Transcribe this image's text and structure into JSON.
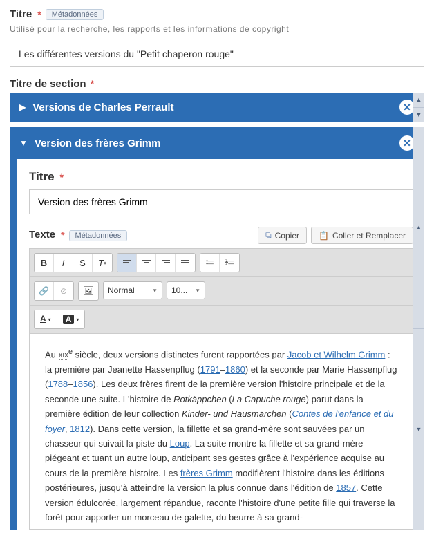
{
  "title_field": {
    "label": "Titre",
    "meta_badge": "Métadonnées",
    "hint": "Utilisé pour la recherche, les rapports et les informations de copyright",
    "value": "Les différentes versions du \"Petit chaperon rouge\""
  },
  "section_label": "Titre de section",
  "sections": [
    {
      "title": "Versions de Charles Perrault",
      "expanded": false
    },
    {
      "title": "Version des frères Grimm",
      "expanded": true
    }
  ],
  "detail": {
    "title_label": "Titre",
    "title_value": "Version des frères Grimm",
    "text_label": "Texte",
    "meta_badge": "Métadonnées",
    "copy_btn": "Copier",
    "paste_btn": "Coller et Remplacer",
    "format_sel": "Normal",
    "size_sel": "10...",
    "content": {
      "t1": "Au ",
      "century": "xix",
      "sup": "e",
      "t2": " siècle, deux versions distinctes furent rapportées par ",
      "link1": "Jacob et Wilhelm Grimm",
      "t3": " : la première par Jeanette Hassenpflug (",
      "link2": "1791",
      "dash1": "–",
      "link3": "1860",
      "t4": ") et la seconde par Marie Hassenpflug (",
      "link4": "1788",
      "dash2": "–",
      "link5": "1856",
      "t5": "). Les deux frères firent de la première version l'histoire principale et de la seconde une suite. L'histoire de ",
      "em1": "Rotkäppchen",
      "t6": " (",
      "em2": "La Capuche rouge",
      "t7": ") parut dans la première édition de leur collection ",
      "em3": "Kinder- und Hausmärchen",
      "t8": " (",
      "link6": "Contes de l'enfance et du foyer",
      "t9": ", ",
      "link7": "1812",
      "t10": "). Dans cette version, la fillette et sa grand-mère sont sauvées par un chasseur qui suivait la piste du ",
      "link8": "Loup",
      "t11": ". La suite montre la fillette et sa grand-mère piégeant et tuant un autre loup, anticipant ses gestes grâce à l'expérience acquise au cours de la première histoire. Les ",
      "link9": "frères Grimm",
      "t12": " modifièrent l'histoire dans les éditions postérieures, jusqu'à atteindre la version la plus connue dans l'édition de ",
      "link10": "1857",
      "t13": ". Cette version édulcorée, largement répandue, raconte l'histoire d'une petite fille qui traverse la forêt pour apporter un morceau de galette, du beurre à sa grand-"
    }
  }
}
